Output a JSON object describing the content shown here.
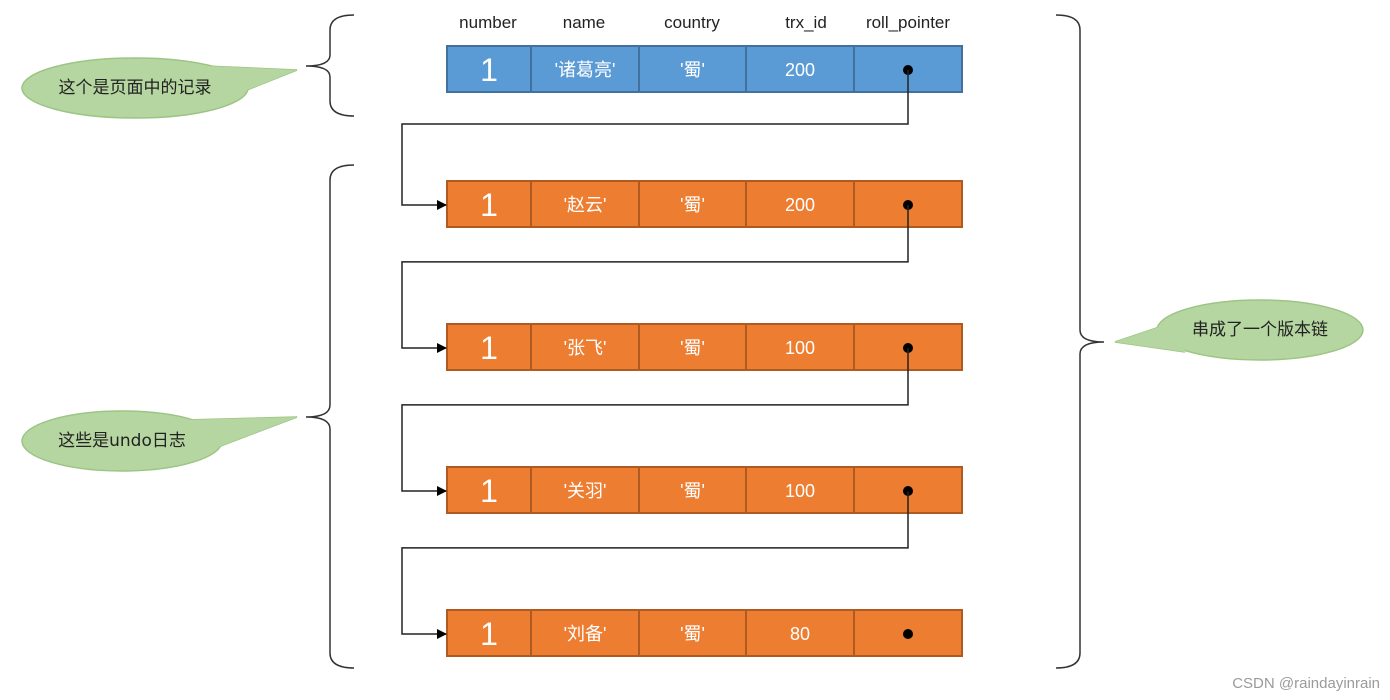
{
  "headers": [
    "number",
    "name",
    "country",
    "trx_id",
    "roll_pointer"
  ],
  "rows": [
    {
      "kind": "record",
      "number": "1",
      "name": "'诸葛亮'",
      "country": "'蜀'",
      "trx_id": "200"
    },
    {
      "kind": "undo",
      "number": "1",
      "name": "'赵云'",
      "country": "'蜀'",
      "trx_id": "200"
    },
    {
      "kind": "undo",
      "number": "1",
      "name": "'张飞'",
      "country": "'蜀'",
      "trx_id": "100"
    },
    {
      "kind": "undo",
      "number": "1",
      "name": "'关羽'",
      "country": "'蜀'",
      "trx_id": "100"
    },
    {
      "kind": "undo",
      "number": "1",
      "name": "'刘备'",
      "country": "'蜀'",
      "trx_id": "80"
    }
  ],
  "callouts": {
    "record": "这个是页面中的记录",
    "undo": "这些是undo日志",
    "chain": "串成了一个版本链"
  },
  "colors": {
    "record_fill": "#5b9bd5",
    "record_border": "#41719c",
    "undo_fill": "#ed7d31",
    "undo_border": "#ae5a21",
    "callout_fill": "#b5d6a0",
    "callout_border": "#9cc585"
  },
  "watermark": "CSDN @raindayinrain"
}
